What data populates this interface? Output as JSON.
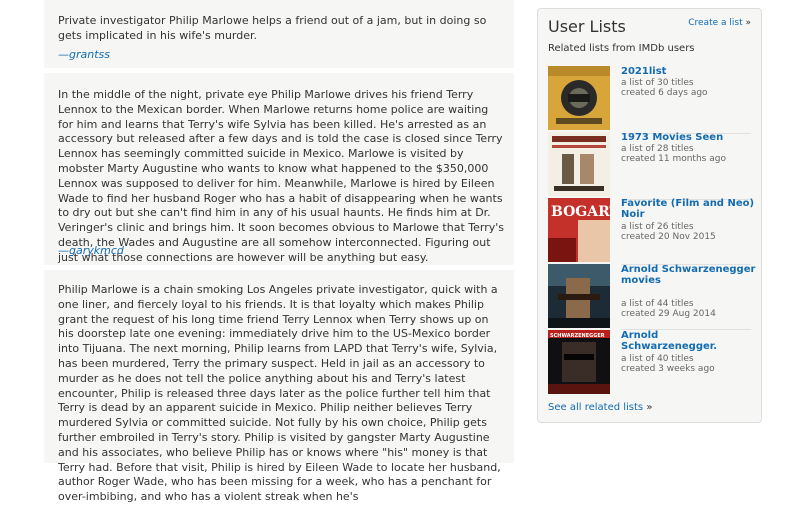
{
  "summaries": [
    {
      "text": "Private investigator Philip Marlowe helps a friend out of a jam, but in doing so gets implicated in his wife's murder.",
      "author": "—grantss"
    },
    {
      "text": "In the middle of the night, private eye Philip Marlowe drives his friend Terry Lennox to the Mexican border. When Marlowe returns home police are waiting for him and learns that Terry's wife Sylvia has been killed. He's arrested as an accessory but released after a few days and is told the case is closed since Terry Lennox has seemingly committed suicide in Mexico. Marlowe is visited by mobster Marty Augustine who wants to know what happened to the $350,000 Lennox was supposed to deliver for him. Meanwhile, Marlowe is hired by Eileen Wade to find her husband Roger who has a habit of disappearing when he wants to dry out but she can't find him in any of his usual haunts. He finds him at Dr. Veringer's clinic and brings him. It soon becomes obvious to Marlowe that Terry's death, the Wades and Augustine are all somehow interconnected. Figuring out just what those connections are however will be anything but easy.",
      "author": "—garykmcd"
    },
    {
      "text": "Philip Marlowe is a chain smoking Los Angeles private investigator, quick with a one liner, and fiercely loyal to his friends. It is that loyalty which makes Philip grant the request of his long time friend Terry Lennox when Terry shows up on his doorstep late one evening: immediately drive him to the US-Mexico border into Tijuana. The next morning, Philip learns from LAPD that Terry's wife, Sylvia, has been murdered, Terry the primary suspect. Held in jail as an accessory to murder as he does not tell the police anything about his and Terry's latest encounter, Philip is released three days later as the police further tell him that Terry is dead by an apparent suicide in Mexico. Philip neither believes Terry murdered Sylvia or committed suicide. Not fully by his own choice, Philip gets further embroiled in Terry's story. Philip is visited by gangster Marty Augustine and his associates, who believe Philip has or knows where \"his\" money is that Terry had. Before that visit, Philip is hired by Eileen Wade to locate her husband, author Roger Wade, who has been missing for a week, who has a penchant for over-imbibing, and who has a violent streak when he's",
      "author": ""
    }
  ],
  "user_lists": {
    "title": "User Lists",
    "create_link": "Create a list",
    "create_arrow": "»",
    "subtitle": "Related lists from IMDb users",
    "items": [
      {
        "title": "2021list",
        "count": "a list of 30 titles",
        "created": "created 6 days ago",
        "poster": "film-poster-icon"
      },
      {
        "title": "1973 Movies Seen",
        "count": "a list of 28 titles",
        "created": "created 11 months ago",
        "poster": "film-poster-icon"
      },
      {
        "title": "Favorite (Film and Neo) Noir",
        "count": "a list of 26 titles",
        "created": "created 20 Nov 2015",
        "poster_text": "BOGART",
        "poster": "film-poster-icon"
      },
      {
        "title": "Arnold Schwarzenegger movies",
        "count": "a list of 44 titles",
        "created": "created 29 Aug 2014",
        "poster": "film-poster-icon"
      },
      {
        "title": "Arnold Schwarzenegger.",
        "count": "a list of 40 titles",
        "created": "created 3 weeks ago",
        "poster_text": "SCHWARZENEGGER",
        "poster": "film-poster-icon"
      }
    ],
    "see_all": "See all related lists",
    "see_all_arrow": "»"
  },
  "colors": {
    "link": "#136cb2",
    "panel_bg": "#f6f6f5",
    "text": "#333333"
  }
}
